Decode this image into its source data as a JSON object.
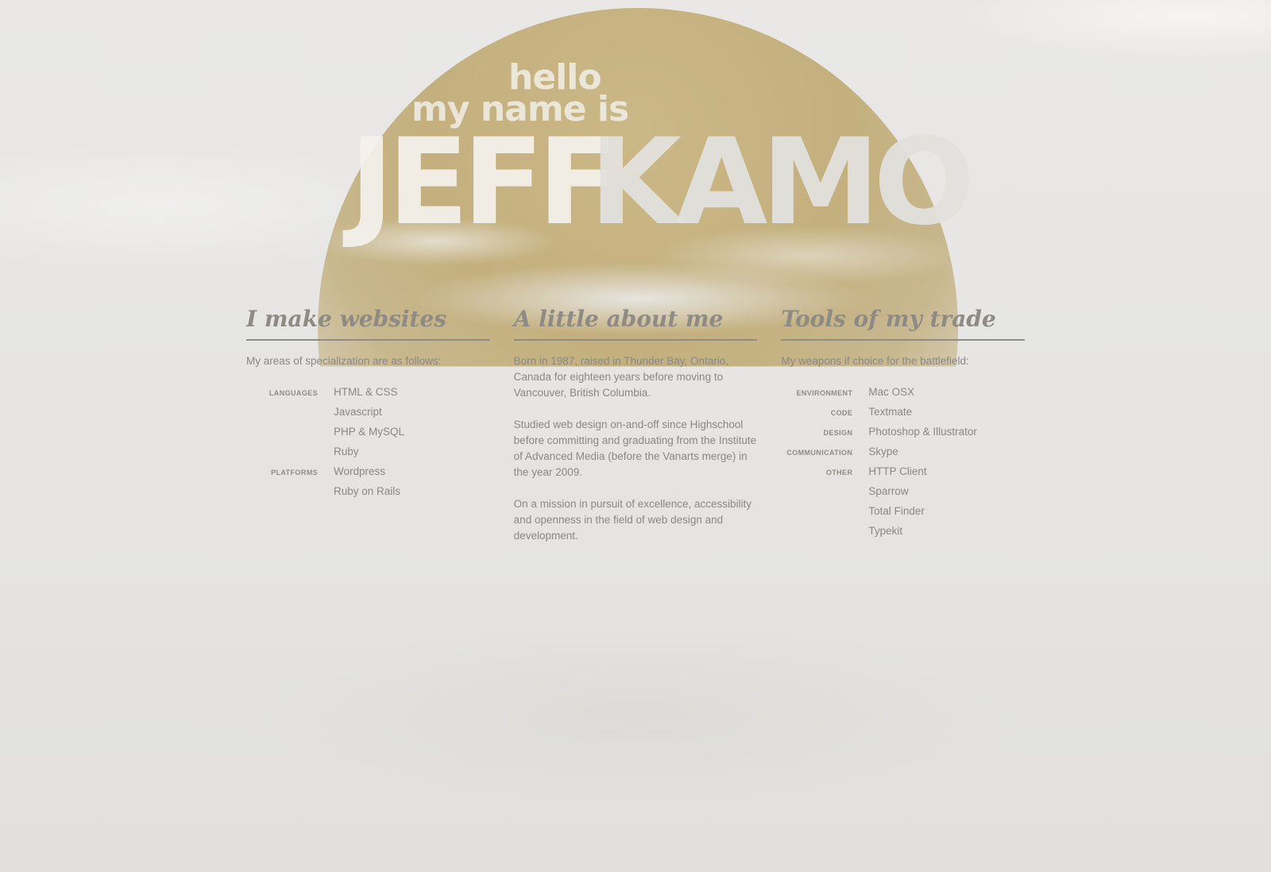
{
  "hero": {
    "hello": "hello",
    "name_is": "my name is",
    "first_name": "JEFF",
    "last_name": "KAMO"
  },
  "websites": {
    "title_prefix": "I make",
    "title_emphasis": "websites",
    "intro": "My areas of specialization are as follows:",
    "rows": [
      {
        "label": "LANGUAGES",
        "value": "HTML & CSS"
      },
      {
        "label": "",
        "value": "Javascript"
      },
      {
        "label": "",
        "value": "PHP & MySQL"
      },
      {
        "label": "",
        "value": "Ruby"
      },
      {
        "label": "PLATFORMS",
        "value": "Wordpress"
      },
      {
        "label": "",
        "value": "Ruby on Rails"
      }
    ]
  },
  "about": {
    "title": "A little about me",
    "paragraphs": [
      "Born in 1987, raised in Thunder Bay, Ontario, Canada for eighteen years before moving to Vancouver, British Columbia.",
      "Studied web design on-and-off since Highschool before committing and graduating from the Institute of Advanced Media (before the Vanarts merge) in the year 2009.",
      "On a mission in pursuit of excellence, accessibility and openness in the field of web design and development."
    ]
  },
  "tools": {
    "title": "Tools of my trade",
    "intro": "My weapons if choice for the battlefield:",
    "rows": [
      {
        "label": "ENVIRONMENT",
        "value": "Mac OSX"
      },
      {
        "label": "CODE",
        "value": "Textmate"
      },
      {
        "label": "DESIGN",
        "value": "Photoshop & Illustrator"
      },
      {
        "label": "COMMUNICATION",
        "value": "Skype"
      },
      {
        "label": "OTHER",
        "value": "HTTP Client"
      },
      {
        "label": "",
        "value": "Sparrow"
      },
      {
        "label": "",
        "value": "Total Finder"
      },
      {
        "label": "",
        "value": "Typekit"
      }
    ]
  },
  "colors": {
    "sun": "#c4b07e",
    "background": "#e8e7e5",
    "text": "#8a8784",
    "rule": "#8e8c89"
  }
}
